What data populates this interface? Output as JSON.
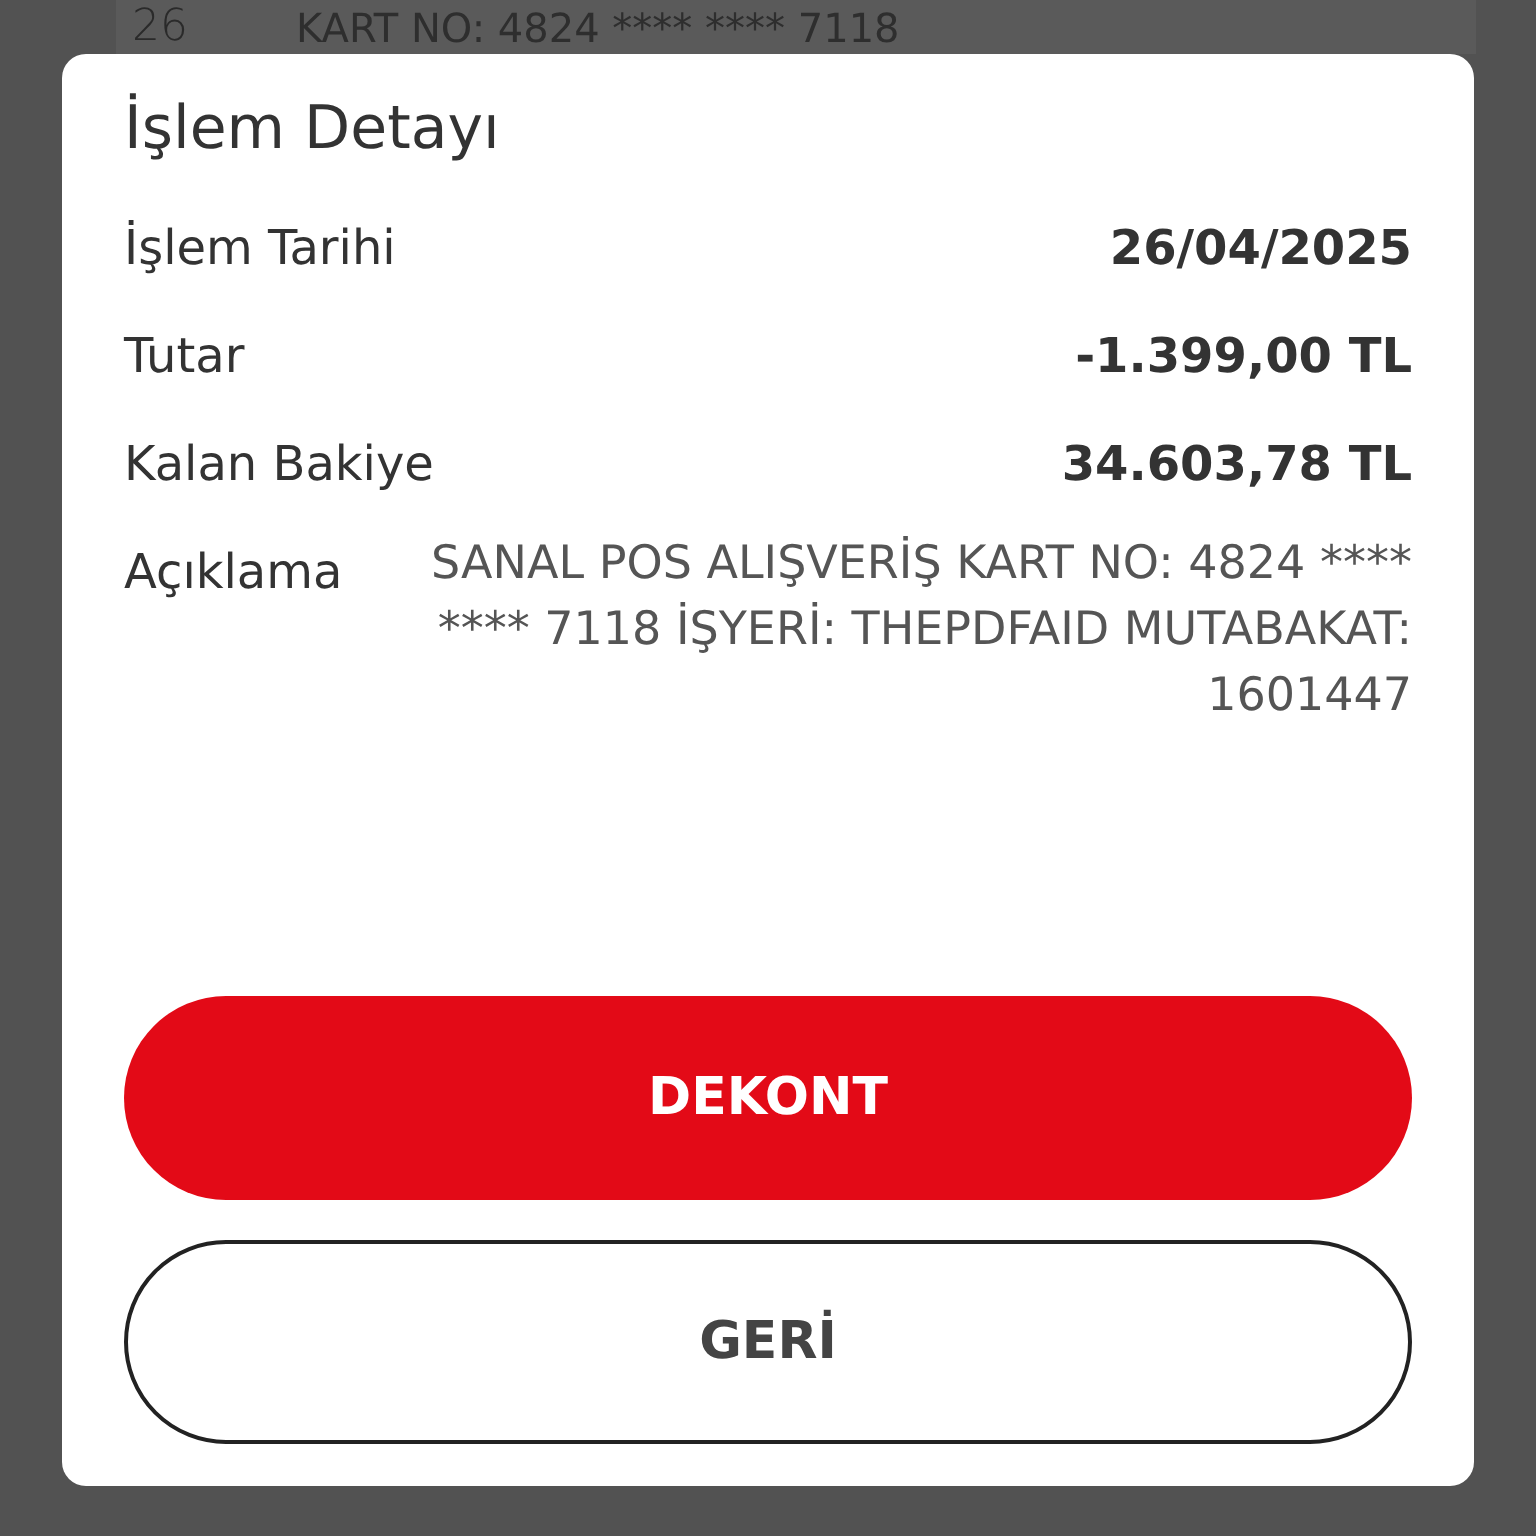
{
  "background_item": {
    "day": "26",
    "text": "KART NO: 4824 **** **** 7118"
  },
  "dialog": {
    "title": "İşlem Detayı",
    "fields": [
      {
        "label": "İşlem Tarihi",
        "value": "26/04/2025",
        "kind": "amount"
      },
      {
        "label": "Tutar",
        "value": "-1.399,00 TL",
        "kind": "amount"
      },
      {
        "label": "Kalan Bakiye",
        "value": "34.603,78 TL",
        "kind": "amount"
      },
      {
        "label": "Açıklama",
        "value": "SANAL POS ALIŞVERİŞ KART NO: 4824 **** **** 7118 İŞYERİ: THEPDFAID MUTABAKAT: 1601447",
        "kind": "description"
      }
    ],
    "buttons": [
      {
        "label": "DEKONT",
        "kind": "primary"
      },
      {
        "label": "GERİ",
        "kind": "secondary"
      }
    ]
  }
}
